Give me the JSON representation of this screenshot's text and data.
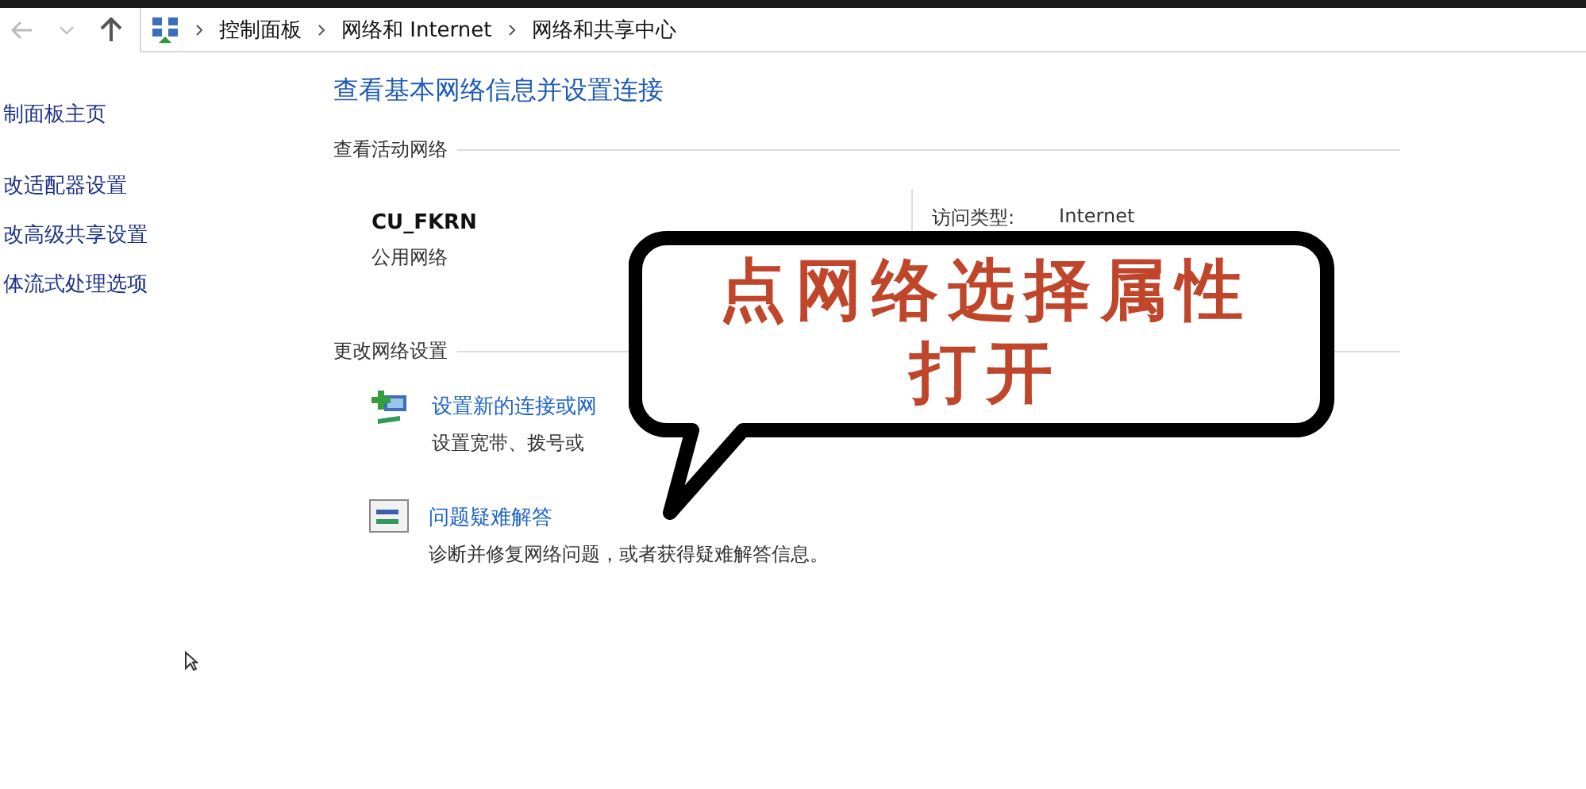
{
  "breadcrumbs": [
    "控制面板",
    "网络和 Internet",
    "网络和共享中心"
  ],
  "sidebar": {
    "items": [
      "制面板主页",
      "改适配器设置",
      "改高级共享设置",
      "体流式处理选项"
    ]
  },
  "main": {
    "title": "查看基本网络信息并设置连接",
    "active_networks": {
      "heading": "查看活动网络",
      "network_name": "CU_FKRN",
      "network_type": "公用网络",
      "access_label": "访问类型:",
      "access_value": "Internet"
    },
    "change_settings": {
      "heading": "更改网络设置",
      "tasks": [
        {
          "kind": "new-connection",
          "link": "设置新的连接或网",
          "description": "设置宽带、拨号或"
        },
        {
          "kind": "troubleshoot",
          "link": "问题疑难解答",
          "description": "诊断并修复网络问题，或者获得疑难解答信息。"
        }
      ]
    }
  },
  "callout": {
    "lines": [
      "点网络选择属性",
      "打开"
    ]
  }
}
